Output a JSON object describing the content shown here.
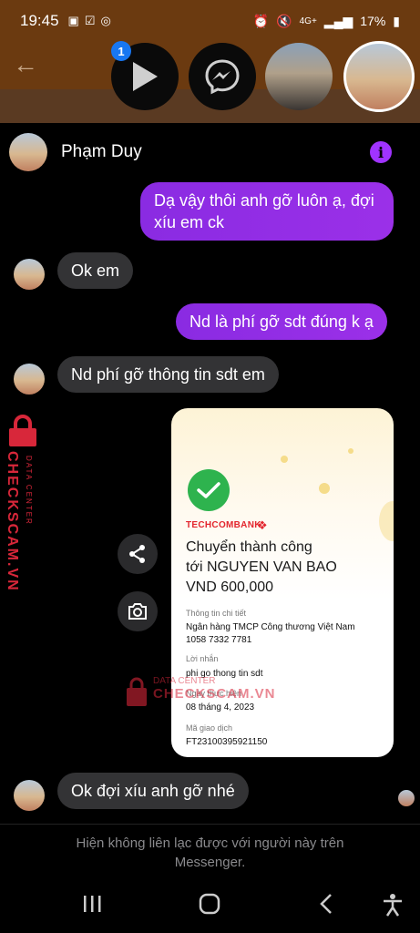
{
  "status_bar": {
    "time": "19:45",
    "network": "4G+",
    "battery": "17%"
  },
  "chat_heads": {
    "badge_count": "1"
  },
  "conversation": {
    "contact_name": "Phạm Duy",
    "messages": [
      {
        "direction": "out",
        "text": "Dạ vậy thôi anh gỡ luôn ạ, đợi xíu em ck"
      },
      {
        "direction": "in",
        "text": "Ok em"
      },
      {
        "direction": "out",
        "text": "Nd là phí gỡ sdt đúng k ạ"
      },
      {
        "direction": "in",
        "text": "Nd phí gỡ thông tin sdt em"
      },
      {
        "direction": "in",
        "text": "Ok đợi xíu anh gỡ nhé"
      }
    ]
  },
  "receipt": {
    "bank_name": "TECHCOMBANK",
    "headline_1": "Chuyển thành công",
    "headline_2": "tới NGUYEN VAN BAO",
    "headline_3": "VND 600,000",
    "details_label": "Thông tin chi tiết",
    "details_bank": "Ngân hàng TMCP Công thương Việt Nam",
    "details_account": "1058 7332 7781",
    "message_label": "Lời nhắn",
    "message_value": "phi go thong tin sdt",
    "date_label": "Ngày thực hiện",
    "date_value": "08 tháng 4, 2023",
    "txn_label": "Mã giao dịch",
    "txn_value": "FT23100395921150"
  },
  "watermark": {
    "brand": "CHECKSCAM.VN",
    "sub": "DATA CENTER"
  },
  "footer": {
    "line1": "Hiện không liên lạc được với người này trên",
    "line2": "Messenger."
  },
  "icons": [
    "back-arrow-icon",
    "play-icon",
    "messenger-icon",
    "info-icon",
    "share-icon",
    "camera-icon",
    "check-icon",
    "lock-icon",
    "recents-icon",
    "home-icon",
    "nav-back-icon",
    "accessibility-icon"
  ],
  "colors": {
    "outgoing_bubble": "#8a2be2",
    "incoming_bubble": "#333335",
    "backdrop": "#6b3a10",
    "watermark": "#d8273a",
    "success": "#2eb34e"
  }
}
